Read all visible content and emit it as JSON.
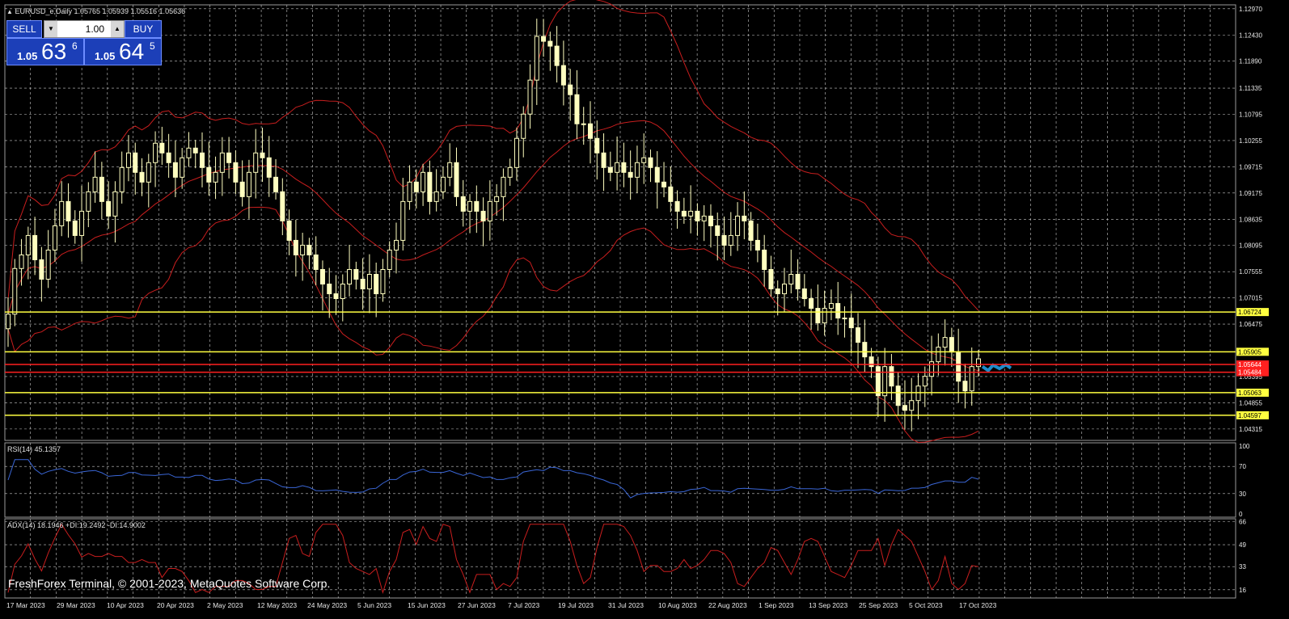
{
  "window": {
    "title": "EURUSD_e,Daily  1.05765 1.05939 1.05516 1.05636",
    "copyright": "FreshForex Terminal, © 2001-2023, MetaQuotes Software Corp."
  },
  "trade_panel": {
    "sell_label": "SELL",
    "buy_label": "BUY",
    "lot_value": "1.00",
    "sell_price_prefix": "1.05",
    "sell_price_big": "63",
    "sell_price_sup": "6",
    "buy_price_prefix": "1.05",
    "buy_price_big": "64",
    "buy_price_sup": "5"
  },
  "indicators": {
    "rsi_label": "RSI(14) 45.1357",
    "adx_label": "ADX(14) 18.1946 +DI:19.2492 -DI:14.9002"
  },
  "colors": {
    "background": "#000000",
    "grid": "#c8c8c8",
    "candle_up": "#000000",
    "candle_body": "#ffffc0",
    "bollinger": "#c81e1e",
    "level_yellow": "#ffff40",
    "level_red": "#ff2020",
    "rsi_line": "#3a66d6",
    "adx_line": "#c81e1e",
    "current": "#1e8ccc"
  },
  "chart_data": [
    {
      "type": "candlestick",
      "name": "price",
      "y_ticks": [
        "1.12970",
        "1.12430",
        "1.11890",
        "1.11335",
        "1.10795",
        "1.10255",
        "1.09715",
        "1.09175",
        "1.08635",
        "1.08095",
        "1.07555",
        "1.07015",
        "1.06475",
        "1.05395",
        "1.04855",
        "1.04315"
      ],
      "ylim": [
        1.0408,
        1.1305
      ],
      "x_labels": [
        "17 Mar 2023",
        "29 Mar 2023",
        "10 Apr 2023",
        "20 Apr 2023",
        "2 May 2023",
        "12 May 2023",
        "24 May 2023",
        "5 Jun 2023",
        "15 Jun 2023",
        "27 Jun 2023",
        "7 Jul 2023",
        "19 Jul 2023",
        "31 Jul 2023",
        "10 Aug 2023",
        "22 Aug 2023",
        "1 Sep 2023",
        "13 Sep 2023",
        "25 Sep 2023",
        "5 Oct 2023",
        "17 Oct 2023"
      ],
      "close": [
        1.0668,
        1.0762,
        1.079,
        1.083,
        1.078,
        1.074,
        1.08,
        1.085,
        1.09,
        1.086,
        1.083,
        1.088,
        1.092,
        1.095,
        1.09,
        1.087,
        1.092,
        1.097,
        1.1,
        1.096,
        1.094,
        1.098,
        1.102,
        1.1,
        1.098,
        1.095,
        1.099,
        1.101,
        1.1,
        1.097,
        1.094,
        1.096,
        1.1,
        1.098,
        1.094,
        1.091,
        1.096,
        1.1,
        1.099,
        1.095,
        1.092,
        1.086,
        1.082,
        1.079,
        1.081,
        1.079,
        1.076,
        1.073,
        1.071,
        1.07,
        1.073,
        1.076,
        1.074,
        1.072,
        1.075,
        1.071,
        1.076,
        1.08,
        1.082,
        1.09,
        1.094,
        1.092,
        1.096,
        1.09,
        1.092,
        1.095,
        1.098,
        1.091,
        1.088,
        1.09,
        1.088,
        1.086,
        1.09,
        1.091,
        1.095,
        1.097,
        1.103,
        1.108,
        1.115,
        1.124,
        1.123,
        1.122,
        1.118,
        1.114,
        1.112,
        1.106,
        1.106,
        1.103,
        1.1,
        1.097,
        1.096,
        1.098,
        1.096,
        1.095,
        1.098,
        1.099,
        1.097,
        1.094,
        1.093,
        1.09,
        1.088,
        1.087,
        1.088,
        1.086,
        1.087,
        1.085,
        1.083,
        1.081,
        1.083,
        1.087,
        1.086,
        1.082,
        1.08,
        1.076,
        1.072,
        1.071,
        1.073,
        1.075,
        1.072,
        1.07,
        1.068,
        1.065,
        1.068,
        1.069,
        1.066,
        1.066,
        1.064,
        1.061,
        1.058,
        1.056,
        1.05,
        1.056,
        1.052,
        1.048,
        1.047,
        1.049,
        1.052,
        1.054,
        1.057,
        1.06,
        1.062,
        1.059,
        1.053,
        1.051,
        1.056,
        1.0576
      ]
    },
    {
      "type": "line",
      "name": "RSI(14)",
      "y_ticks": [
        "100",
        "70",
        "30",
        "0"
      ],
      "ylim": [
        0,
        100
      ]
    },
    {
      "type": "line",
      "name": "ADX(14)",
      "y_ticks": [
        "66",
        "49",
        "33",
        "16"
      ],
      "ylim": [
        10,
        68
      ]
    }
  ],
  "levels": {
    "yellow": [
      {
        "value": 1.06724,
        "label": "1.06724"
      },
      {
        "value": 1.05905,
        "label": "1.05905"
      },
      {
        "value": 1.05063,
        "label": "1.05063"
      },
      {
        "value": 1.04597,
        "label": "1.04597"
      }
    ],
    "red": [
      {
        "value": 1.05644,
        "label": "1.05644"
      },
      {
        "value": 1.05484,
        "label": "1.05484"
      }
    ]
  }
}
